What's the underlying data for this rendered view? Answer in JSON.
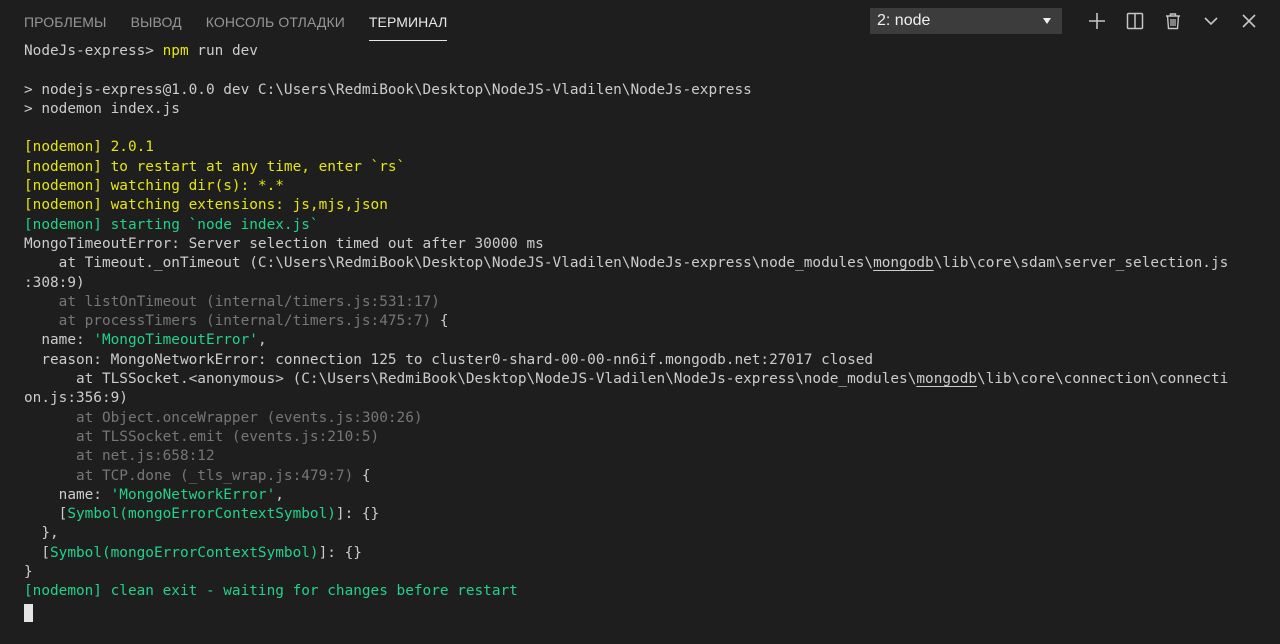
{
  "tabs": [
    {
      "label": "ПРОБЛЕМЫ",
      "active": false
    },
    {
      "label": "ВЫВОД",
      "active": false
    },
    {
      "label": "КОНСОЛЬ ОТЛАДКИ",
      "active": false
    },
    {
      "label": "ТЕРМИНАЛ",
      "active": true
    }
  ],
  "terminal_select": {
    "value": "2: node"
  },
  "icons": [
    "plus-icon",
    "split-icon",
    "trash-icon",
    "chevron-down-icon",
    "close-icon"
  ],
  "colors": {
    "background": "#1e1e1e",
    "yellow": "#e5e510",
    "green": "#23d18b",
    "grey": "#767676",
    "text": "#cccccc"
  },
  "terminal": {
    "lines": [
      [
        {
          "t": "NodeJs-express> ",
          "c": "w"
        },
        {
          "t": "npm",
          "c": "y"
        },
        {
          "t": " run dev",
          "c": "w"
        }
      ],
      [],
      [
        {
          "t": "> nodejs-express@1.0.0 dev C:\\Users\\RedmiBook\\Desktop\\NodeJS-Vladilen\\NodeJs-express",
          "c": "w"
        }
      ],
      [
        {
          "t": "> nodemon index.js",
          "c": "w"
        }
      ],
      [],
      [
        {
          "t": "[nodemon] 2.0.1",
          "c": "y"
        }
      ],
      [
        {
          "t": "[nodemon] to restart at any time, enter `rs`",
          "c": "y"
        }
      ],
      [
        {
          "t": "[nodemon] watching dir(s): *.*",
          "c": "y"
        }
      ],
      [
        {
          "t": "[nodemon] watching extensions: js,mjs,json",
          "c": "y"
        }
      ],
      [
        {
          "t": "[nodemon] starting `node index.js`",
          "c": "g"
        }
      ],
      [
        {
          "t": "MongoTimeoutError: Server selection timed out after 30000 ms",
          "c": "w"
        }
      ],
      [
        {
          "t": "    at Timeout._onTimeout (C:\\Users\\RedmiBook\\Desktop\\NodeJS-Vladilen\\NodeJs-express\\node_modules\\",
          "c": "w"
        },
        {
          "t": "mongodb",
          "c": "w",
          "u": true
        },
        {
          "t": "\\lib\\core\\sdam\\server_selection.js",
          "c": "w"
        }
      ],
      [
        {
          "t": ":308:9)",
          "c": "w"
        }
      ],
      [
        {
          "t": "    at listOnTimeout (internal/timers.js:531:17)",
          "c": "gr"
        }
      ],
      [
        {
          "t": "    at processTimers (internal/timers.js:475:7)",
          "c": "gr"
        },
        {
          "t": " {",
          "c": "w"
        }
      ],
      [
        {
          "t": "  name: ",
          "c": "w"
        },
        {
          "t": "'MongoTimeoutError'",
          "c": "g"
        },
        {
          "t": ",",
          "c": "w"
        }
      ],
      [
        {
          "t": "  reason: MongoNetworkError: connection 125 to cluster0-shard-00-00-nn6if.mongodb.net:27017 closed",
          "c": "w"
        }
      ],
      [
        {
          "t": "      at TLSSocket.<anonymous> (C:\\Users\\RedmiBook\\Desktop\\NodeJS-Vladilen\\NodeJs-express\\node_modules\\",
          "c": "w"
        },
        {
          "t": "mongodb",
          "c": "w",
          "u": true
        },
        {
          "t": "\\lib\\core\\connection\\connecti",
          "c": "w"
        }
      ],
      [
        {
          "t": "on.js:356:9)",
          "c": "w"
        }
      ],
      [
        {
          "t": "      at Object.onceWrapper (events.js:300:26)",
          "c": "gr"
        }
      ],
      [
        {
          "t": "      at TLSSocket.emit (events.js:210:5)",
          "c": "gr"
        }
      ],
      [
        {
          "t": "      at net.js:658:12",
          "c": "gr"
        }
      ],
      [
        {
          "t": "      at TCP.done (_tls_wrap.js:479:7)",
          "c": "gr"
        },
        {
          "t": " {",
          "c": "w"
        }
      ],
      [
        {
          "t": "    name: ",
          "c": "w"
        },
        {
          "t": "'MongoNetworkError'",
          "c": "g"
        },
        {
          "t": ",",
          "c": "w"
        }
      ],
      [
        {
          "t": "    [",
          "c": "w"
        },
        {
          "t": "Symbol(mongoErrorContextSymbol)",
          "c": "g"
        },
        {
          "t": "]: {}",
          "c": "w"
        }
      ],
      [
        {
          "t": "  },",
          "c": "w"
        }
      ],
      [
        {
          "t": "  [",
          "c": "w"
        },
        {
          "t": "Symbol(mongoErrorContextSymbol)",
          "c": "g"
        },
        {
          "t": "]: {}",
          "c": "w"
        }
      ],
      [
        {
          "t": "}",
          "c": "w"
        }
      ],
      [
        {
          "t": "[nodemon] clean exit - waiting for changes before restart",
          "c": "g"
        }
      ]
    ]
  }
}
